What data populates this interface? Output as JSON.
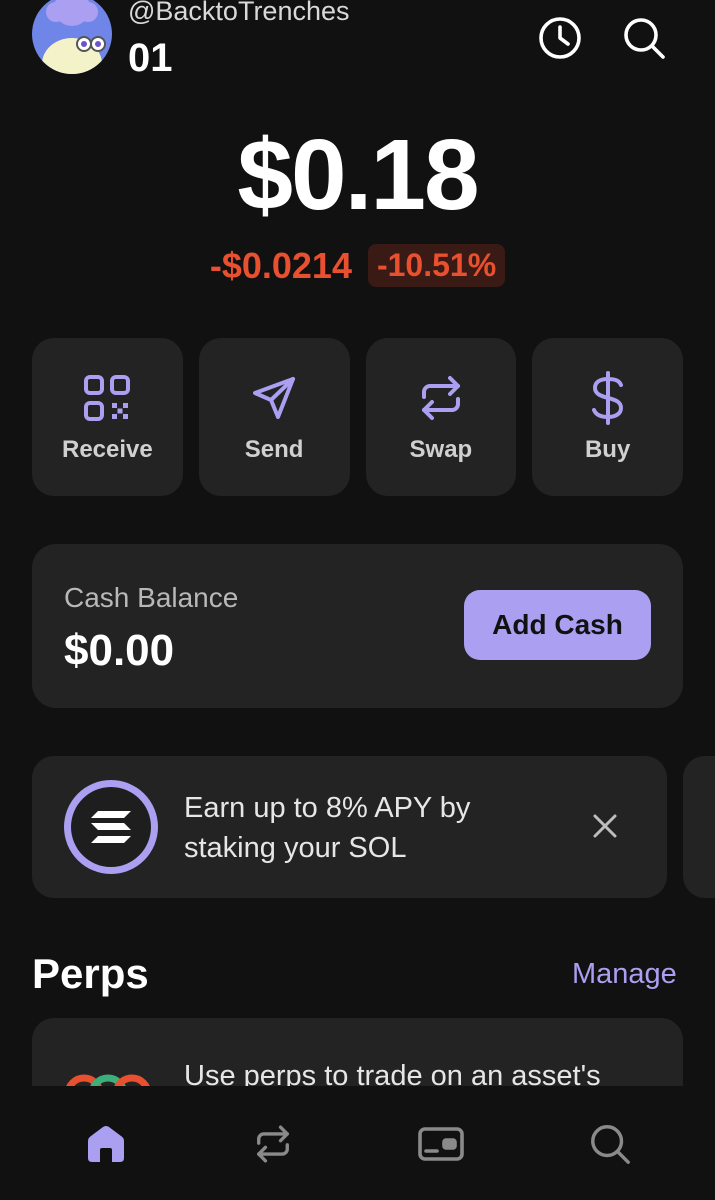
{
  "header": {
    "handle": "@BacktoTrenches",
    "account_name": "01"
  },
  "balance": {
    "total": "$0.18",
    "change_amount": "-$0.0214",
    "change_percent": "-10.51%"
  },
  "actions": [
    {
      "label": "Receive",
      "icon": "qr-code-icon"
    },
    {
      "label": "Send",
      "icon": "send-icon"
    },
    {
      "label": "Swap",
      "icon": "swap-icon"
    },
    {
      "label": "Buy",
      "icon": "dollar-icon"
    }
  ],
  "cash": {
    "label": "Cash Balance",
    "value": "$0.00",
    "button_label": "Add Cash"
  },
  "staking_banner": {
    "text": "Earn up to 8% APY by staking your SOL"
  },
  "perps": {
    "title": "Perps",
    "manage_label": "Manage",
    "card_text": "Use perps to trade on an asset's"
  },
  "nav": {
    "items": [
      "home-icon",
      "swap-icon",
      "wallet-icon",
      "search-icon"
    ],
    "active": "home-icon"
  },
  "colors": {
    "accent": "#ab9ff2",
    "negative": "#e8502f",
    "background": "#111111",
    "card": "#232323"
  }
}
